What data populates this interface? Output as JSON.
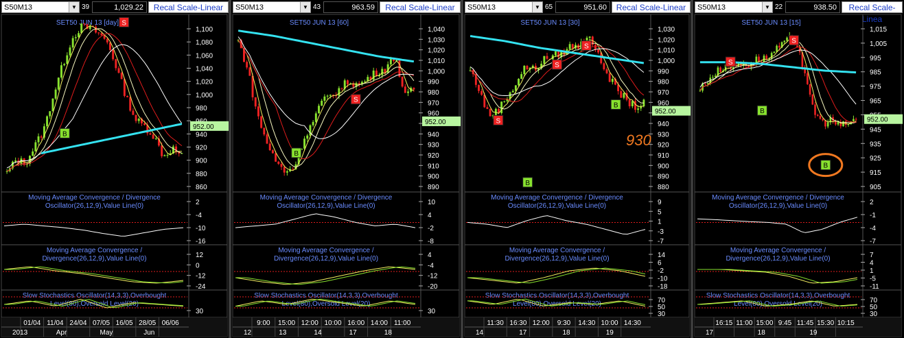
{
  "colors": {
    "background": "#000000",
    "grid": "#5a5a5a",
    "price_white": "#ffffff",
    "ma_yellow": "#f4f060",
    "ma_red": "#e01c1c",
    "ma_cyan": "#34e2f0",
    "label_blue": "#6a8cff",
    "buy_green": "#88e22e",
    "sell_red": "#ee2222",
    "last_price_box": "#b8f5a0",
    "annotation_orange": "#f07820"
  },
  "panels": [
    {
      "symbol": "S50M13",
      "top_partial": "39",
      "price": "1,029.22",
      "recal": "Recal Scale-Linear",
      "chart_data": {
        "type": "candlestick",
        "title": "SET50 JUN 13",
        "timeframe": "[day]",
        "y_ticks": [
          "1,100",
          "1,080",
          "1,060",
          "1,040",
          "1,020",
          "1,000",
          "980",
          "960",
          "940",
          "920",
          "900",
          "880",
          "860"
        ],
        "last_price": "952.00",
        "x_ticks": [
          "01/04",
          "11/04",
          "24/04",
          "07/05",
          "16/05",
          "28/05",
          "06/06"
        ],
        "x_months": [
          "2013",
          "Apr",
          "May",
          "Jun"
        ],
        "signals": [
          {
            "type": "B",
            "price": 941
          },
          {
            "type": "S",
            "price": 1110
          }
        ]
      },
      "ind1": {
        "label_l1": "Moving Average Convergence / Divergence",
        "label_l2": "Oscillator(26,12,9),Value Line(0)",
        "ticks": [
          "2",
          "-4",
          "-10",
          "-16"
        ]
      },
      "ind2": {
        "label_l1": "Moving Average Convergence /",
        "label_l2": "Divergence(26,12,9),Value Line(0)",
        "ticks": [
          "12",
          "0",
          "-12",
          "-24"
        ]
      },
      "ind3": {
        "label_l1": "Slow Stochastics Oscillator(14,3,3),Overbought",
        "label_l2": "Level(80),Oversold Level(20)",
        "ticks": [
          "30"
        ]
      }
    },
    {
      "symbol": "S50M13",
      "top_partial": "43",
      "price": "963.59",
      "recal": "Recal Scale-Linear",
      "chart_data": {
        "type": "candlestick",
        "title": "SET50 JUN 13",
        "timeframe": "[60]",
        "y_ticks": [
          "1,040",
          "1,030",
          "1,020",
          "1,010",
          "1,000",
          "990",
          "980",
          "970",
          "960",
          "950",
          "940",
          "930",
          "920",
          "910",
          "900",
          "890"
        ],
        "last_price": "952.00",
        "x_ticks": [
          "9:00",
          "15:00",
          "12:00",
          "10:00",
          "16:00",
          "14:00",
          "11:00"
        ],
        "x_days": [
          "12",
          "13",
          "14",
          "17",
          "18"
        ],
        "signals": [
          {
            "type": "B",
            "price": 922
          },
          {
            "type": "S",
            "price": 973
          }
        ]
      },
      "ind1": {
        "label_l1": "Moving Average Convergence / Divergence",
        "label_l2": "Oscillator(26,12,9),Value Line(0)",
        "ticks": [
          "10",
          "4",
          "-2",
          "-8"
        ]
      },
      "ind2": {
        "label_l1": "Moving Average Convergence /",
        "label_l2": "Divergence(26,12,9),Value Line(0)",
        "ticks": [
          "4",
          "-4",
          "-12",
          "-20"
        ]
      },
      "ind3": {
        "label_l1": "Slow Stochastics Oscillator(14,3,3),Overbought",
        "label_l2": "Level(80),Oversold Level(20)",
        "ticks": [
          "30"
        ]
      }
    },
    {
      "symbol": "S50M13",
      "top_partial": "65",
      "price": "951.60",
      "recal": "Recal Scale-Linear",
      "chart_data": {
        "type": "candlestick",
        "title": "SET50 JUN 13",
        "timeframe": "[30]",
        "y_ticks": [
          "1,030",
          "1,020",
          "1,010",
          "1,000",
          "990",
          "980",
          "970",
          "960",
          "950",
          "940",
          "930",
          "920",
          "910",
          "900",
          "890",
          "880"
        ],
        "last_price": "952.00",
        "annotation": "930",
        "x_ticks": [
          "11:30",
          "16:30",
          "12:00",
          "9:30",
          "14:30",
          "10:00",
          "14:30"
        ],
        "x_days": [
          "14",
          "17",
          "18",
          "19"
        ],
        "signals": [
          {
            "type": "S",
            "price": 943
          },
          {
            "type": "B",
            "price": 884
          },
          {
            "type": "S",
            "price": 996
          },
          {
            "type": "S",
            "price": 1014
          },
          {
            "type": "B",
            "price": 958
          }
        ]
      },
      "ind1": {
        "label_l1": "Moving Average Convergence / Divergence",
        "label_l2": "Oscillator(26,12,9),Value Line(0)",
        "ticks": [
          "9",
          "5",
          "1",
          "-3",
          "-7"
        ]
      },
      "ind2": {
        "label_l1": "Moving Average Convergence /",
        "label_l2": "Divergence(26,12,9),Value Line(0)",
        "ticks": [
          "14",
          "6",
          "-2",
          "-10",
          "-18"
        ]
      },
      "ind3": {
        "label_l1": "Slow Stochastics Oscillator(14,3,3),Overbought",
        "label_l2": "Level(80),Oversold Level(20)",
        "ticks": [
          "70",
          "50",
          "30"
        ]
      }
    },
    {
      "symbol": "S50M13",
      "top_partial": "22",
      "price": "938.50",
      "recal": "Recal Scale-Linea",
      "chart_data": {
        "type": "candlestick",
        "title": "SET50 JUN 13",
        "timeframe": "[15]",
        "y_ticks": [
          "1,015",
          "1,005",
          "995",
          "985",
          "975",
          "965",
          "955",
          "945",
          "935",
          "925",
          "915",
          "905"
        ],
        "last_price": "952.00",
        "x_ticks": [
          "16:15",
          "11:00",
          "15:00",
          "9:45",
          "11:45",
          "15:30",
          "10:15"
        ],
        "x_days": [
          "17",
          "18",
          "19"
        ],
        "signals": [
          {
            "type": "S",
            "price": 992
          },
          {
            "type": "B",
            "price": 958
          },
          {
            "type": "S",
            "price": 1007
          },
          {
            "type": "B",
            "price": 920
          }
        ]
      },
      "ind1": {
        "label_l1": "Moving Average Convergence / Divergence",
        "label_l2": "Oscillator(26,12,9),Value Line(0)",
        "ticks": [
          "2",
          "-1",
          "-4",
          "-7"
        ]
      },
      "ind2": {
        "label_l1": "Moving Average Convergence /",
        "label_l2": "Divergence(26,12,9),Value Line(0)",
        "ticks": [
          "7",
          "4",
          "1",
          "-5",
          "-11"
        ]
      },
      "ind3": {
        "label_l1": "Slow Stochastics Oscillator(14,3,3),Overbought",
        "label_l2": "Level(80),Oversold Level(20)",
        "ticks": [
          "70",
          "50",
          "30"
        ]
      }
    }
  ]
}
